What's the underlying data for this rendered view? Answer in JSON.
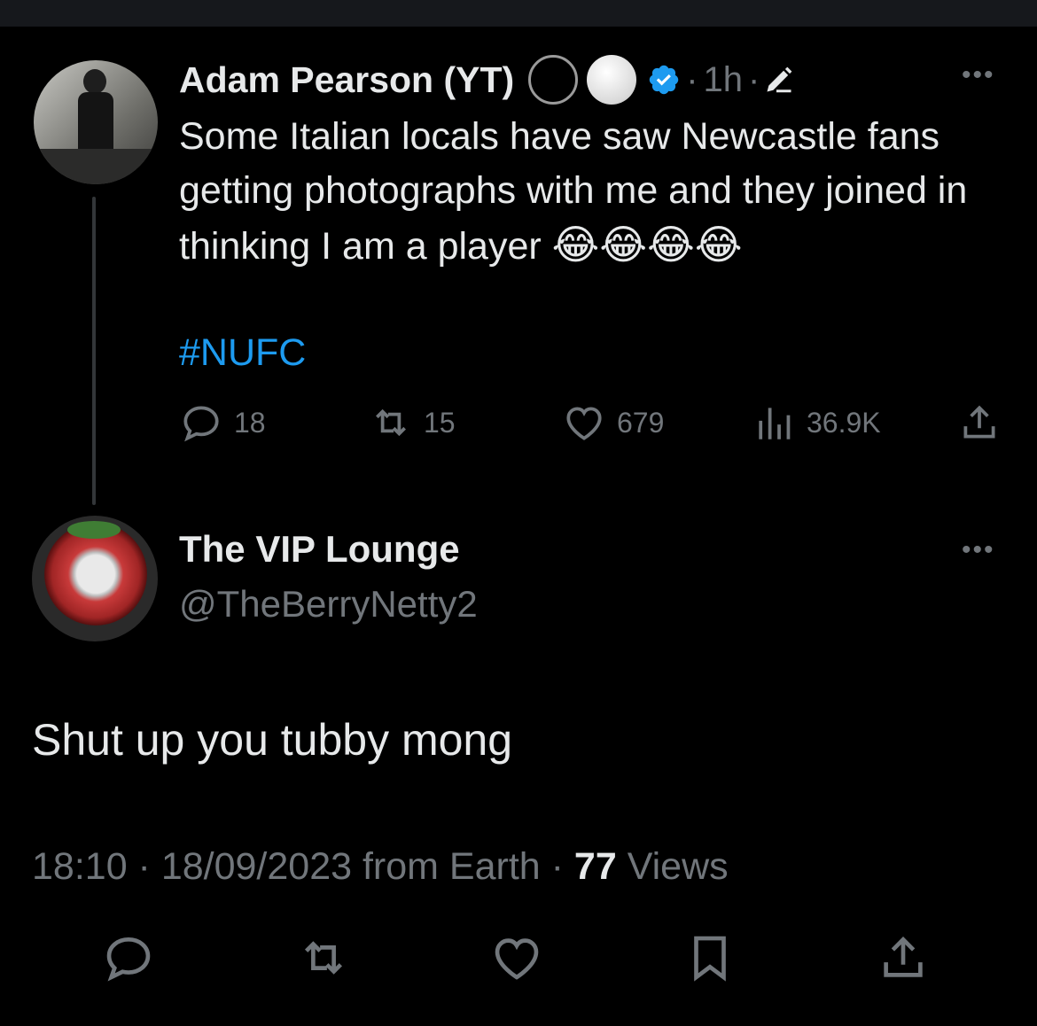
{
  "parent_tweet": {
    "author_name": "Adam Pearson (YT)",
    "time": "1h",
    "separator": "·",
    "text": "Some Italian locals have saw Newcastle fans getting photographs with me and they joined in thinking I am a player",
    "emojis": "😂😂😂😂",
    "hashtag": "#NUFC",
    "replies": "18",
    "reposts": "15",
    "likes": "679",
    "views": "36.9K"
  },
  "reply_tweet": {
    "author_name": "The VIP Lounge",
    "handle": "@TheBerryNetty2",
    "text": "Shut up you tubby mong",
    "timestamp": "18:10 · 18/09/2023 from Earth · ",
    "views_count": "77",
    "views_label": " Views"
  },
  "colors": {
    "background": "#000000",
    "text_primary": "#e7e9ea",
    "text_secondary": "#71767b",
    "accent": "#1d9bf0"
  },
  "icons": {
    "verified": "verified-badge-icon",
    "edit": "pencil-icon",
    "more": "more-icon",
    "reply": "reply-icon",
    "repost": "repost-icon",
    "like": "heart-icon",
    "views": "views-icon",
    "share": "share-icon",
    "bookmark": "bookmark-icon"
  }
}
